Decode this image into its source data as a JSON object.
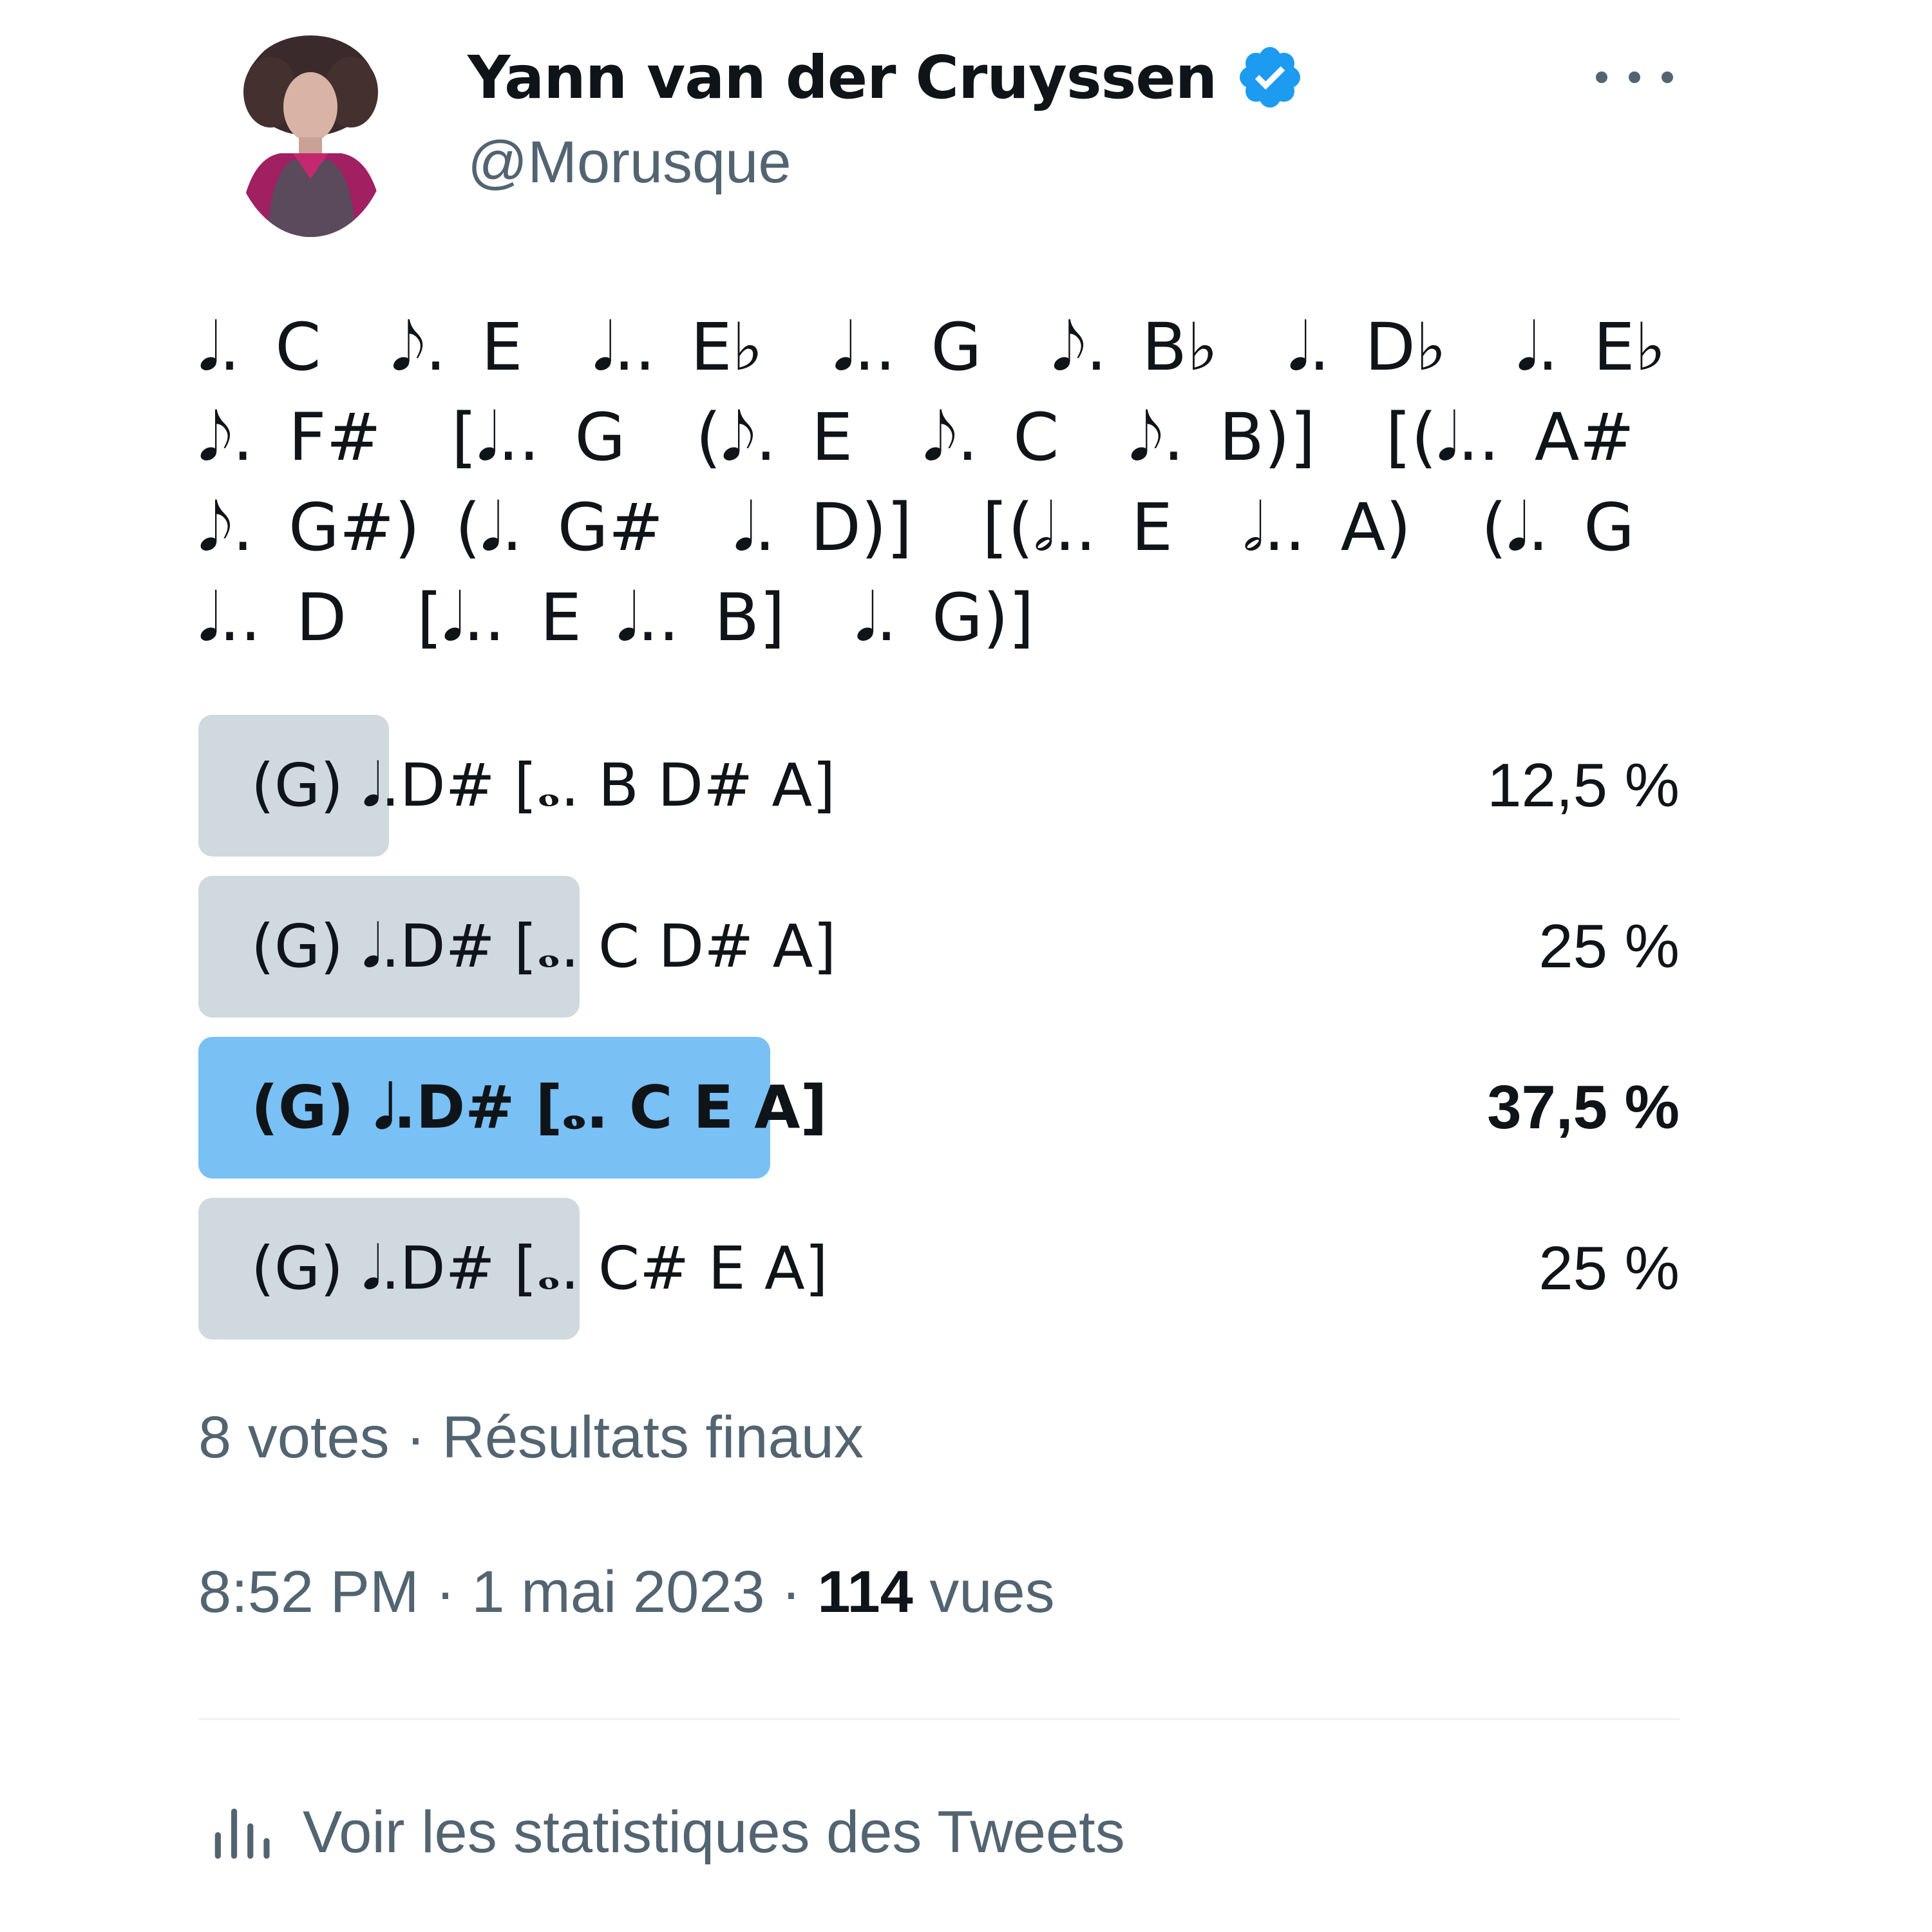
{
  "author": {
    "name": "Yann van der Cruyssen",
    "handle": "@Morusque",
    "verified": true,
    "avatar_icon": "profile-photo"
  },
  "more_menu_icon": "more-horizontal-icon",
  "tweet_text": "𝅘𝅥. C  𝅘𝅥𝅮. E  𝅘𝅥.. E♭  𝅘𝅥.. G  𝅘𝅥𝅮. B♭  𝅘𝅥. D♭  𝅘𝅥. E♭  𝅘𝅥𝅮. F#  [𝅘𝅥.. G  (𝅘𝅥𝅮. E  𝅘𝅥𝅮. C  𝅘𝅥𝅮. B)]  [(𝅘𝅥.. A#  𝅘𝅥𝅮. G#) (𝅘𝅥. G#  𝅘𝅥. D)]  [(𝅗𝅥.. E  𝅗𝅥.. A)  (𝅘𝅥. G  𝅘𝅥.. D  [𝅘𝅥.. E 𝅘𝅥.. B]  𝅘𝅥. G)]",
  "poll": {
    "options": [
      {
        "label": "(G) 𝅘𝅥.D# [𝅝. B D# A]",
        "percent_text": "12,5 %",
        "percent": 12.5,
        "winner": false
      },
      {
        "label": "(G) 𝅘𝅥.D# [𝅝.  C D# A]",
        "percent_text": "25 %",
        "percent": 25,
        "winner": false
      },
      {
        "label": "(G) 𝅘𝅥.D# [𝅝.  C E A]",
        "percent_text": "37,5 %",
        "percent": 37.5,
        "winner": true
      },
      {
        "label": "(G) 𝅘𝅥.D# [𝅝.  C# E A]",
        "percent_text": "25 %",
        "percent": 25,
        "winner": false
      }
    ],
    "meta": "8 votes · Résultats finaux"
  },
  "tweet_meta": {
    "time": "8:52 PM",
    "date": "1 mai 2023",
    "views_count": "114",
    "views_label": "vues"
  },
  "stats_link": {
    "label": "Voir les statistiques des Tweets",
    "icon": "analytics-bar-chart-icon"
  },
  "colors": {
    "bar_default": "#cfd9de",
    "bar_winner": "#79c0f5",
    "verified_blue": "#1d9bf0",
    "secondary_text": "#536471"
  }
}
